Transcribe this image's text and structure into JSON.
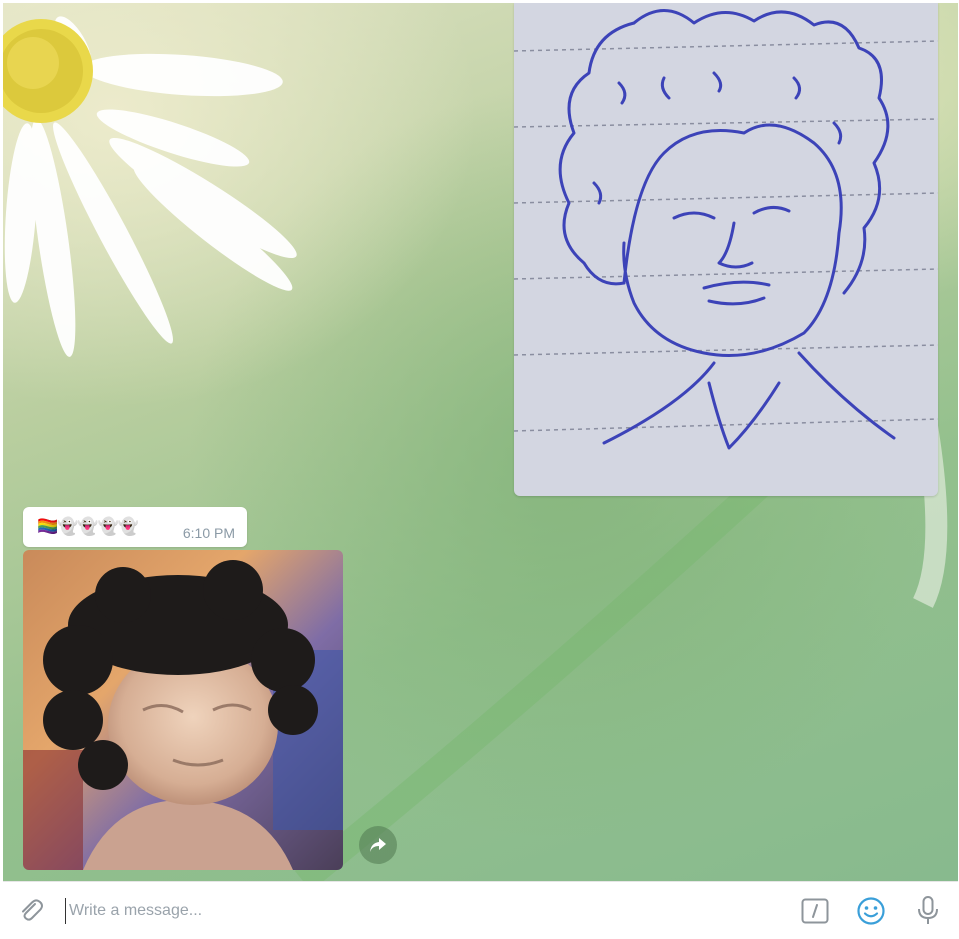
{
  "message": {
    "caption": "🏳️‍🌈👻👻👻👻",
    "time": "6:10 PM"
  },
  "images": {
    "sketch": "hand-drawn pen sketch of a curly-haired person on lined paper",
    "generated": "painted-style portrait of a curly-haired child"
  },
  "composer": {
    "placeholder": "Write a message..."
  },
  "icons": {
    "attach": "paperclip-icon",
    "commands": "slash-commands-icon",
    "emoji": "smiley-icon",
    "voice": "microphone-icon",
    "share": "forward-arrow-icon"
  },
  "colors": {
    "accent": "#3a9fd9",
    "icon_gray": "#8e959b",
    "time_gray": "#8b9aa6"
  }
}
